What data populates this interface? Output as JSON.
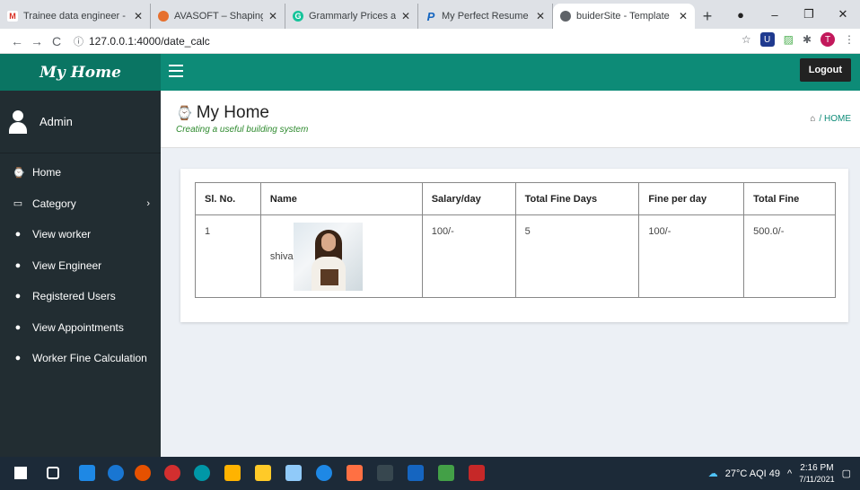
{
  "browser": {
    "tabs": [
      {
        "title": "Trainee data engineer - th",
        "icon": "gmail-icon",
        "color": "#d93025"
      },
      {
        "title": "AVASOFT – Shaping Next",
        "icon": "avasoft-icon",
        "color": "#e6702e"
      },
      {
        "title": "Grammarly Prices and Pla",
        "icon": "grammarly-icon",
        "color": "#15c39a"
      },
      {
        "title": "My Perfect Resume",
        "icon": "p-icon",
        "color": "#1565c0"
      },
      {
        "title": "buiderSite - Template",
        "icon": "globe-icon",
        "color": "#5f6368"
      }
    ],
    "url": "127.0.0.1:4000/date_calc",
    "profile_initial": "T"
  },
  "app": {
    "brand": "My Home",
    "logout_label": "Logout",
    "user_name": "Admin",
    "menu": [
      {
        "label": "Home",
        "icon": "dashboard-icon"
      },
      {
        "label": "Category",
        "icon": "laptop-icon",
        "has_children": true
      },
      {
        "label": "View worker",
        "icon": "circle-icon"
      },
      {
        "label": "View Engineer",
        "icon": "circle-icon"
      },
      {
        "label": "Registered Users",
        "icon": "circle-icon"
      },
      {
        "label": "View Appointments",
        "icon": "circle-icon"
      },
      {
        "label": "Worker Fine Calculation",
        "icon": "circle-icon"
      }
    ],
    "page_title": "My Home",
    "page_subtitle": "Creating a useful building system",
    "breadcrumb": "/ HOME",
    "table": {
      "headers": [
        "Sl. No.",
        "Name",
        "Salary/day",
        "Total Fine Days",
        "Fine per day",
        "Total Fine"
      ],
      "rows": [
        {
          "sl": "1",
          "name": "shiva",
          "salary": "100/-",
          "fine_days": "5",
          "fine_per_day": "100/-",
          "total_fine": "500.0/-"
        }
      ]
    }
  },
  "taskbar": {
    "weather": "27°C AQI 49",
    "time": "2:16 PM",
    "date": "7/11/2021"
  }
}
